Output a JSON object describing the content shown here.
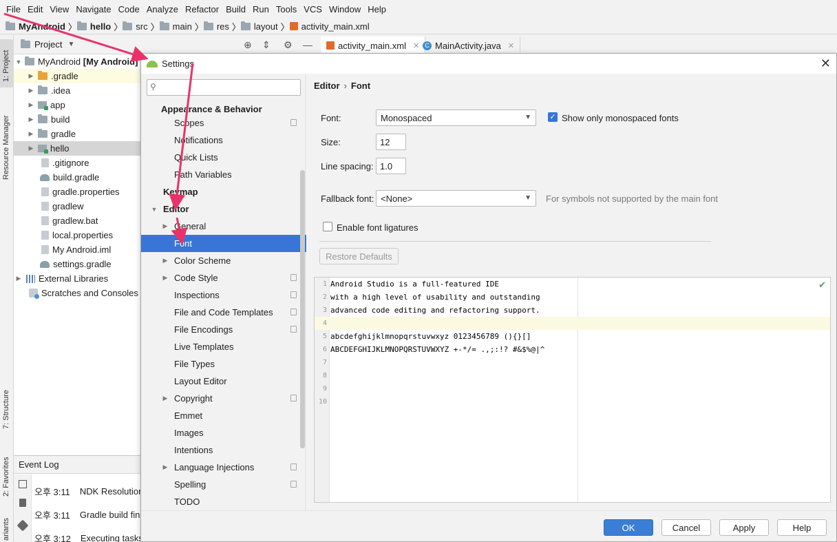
{
  "menu": [
    "File",
    "Edit",
    "View",
    "Navigate",
    "Code",
    "Analyze",
    "Refactor",
    "Build",
    "Run",
    "Tools",
    "VCS",
    "Window",
    "Help"
  ],
  "breadcrumb": [
    "MyAndroid",
    "hello",
    "src",
    "main",
    "res",
    "layout",
    "activity_main.xml"
  ],
  "left_strip": {
    "project": "1: Project",
    "resource_manager": "Resource Manager",
    "structure": "7: Structure",
    "favorites": "2: Favorites",
    "variants": "ariants"
  },
  "project_panel": {
    "header": "Project",
    "tree": [
      {
        "label": "MyAndroid",
        "suffix": "[My Android]"
      },
      {
        "label": ".gradle"
      },
      {
        "label": ".idea"
      },
      {
        "label": "app"
      },
      {
        "label": "build"
      },
      {
        "label": "gradle"
      },
      {
        "label": "hello"
      },
      {
        "label": ".gitignore"
      },
      {
        "label": "build.gradle"
      },
      {
        "label": "gradle.properties"
      },
      {
        "label": "gradlew"
      },
      {
        "label": "gradlew.bat"
      },
      {
        "label": "local.properties"
      },
      {
        "label": "My Android.iml"
      },
      {
        "label": "settings.gradle"
      },
      {
        "label": "External Libraries"
      },
      {
        "label": "Scratches and Consoles"
      }
    ]
  },
  "event_log": {
    "title": "Event Log",
    "rows": [
      {
        "time": "오후 3:11",
        "text": "NDK Resolution"
      },
      {
        "time": "오후 3:11",
        "text": "Gradle build fini"
      },
      {
        "time": "오후 3:12",
        "text": "Executing tasks:"
      }
    ]
  },
  "editor_tabs": [
    {
      "label": "activity_main.xml",
      "active": true
    },
    {
      "label": "MainActivity.java",
      "active": false
    }
  ],
  "dialog": {
    "title": "Settings",
    "nav": {
      "search_placeholder": "",
      "items": [
        {
          "label": "Appearance & Behavior"
        },
        {
          "label": "Scopes"
        },
        {
          "label": "Notifications"
        },
        {
          "label": "Quick Lists"
        },
        {
          "label": "Path Variables"
        },
        {
          "label": "Keymap"
        },
        {
          "label": "Editor"
        },
        {
          "label": "General"
        },
        {
          "label": "Font"
        },
        {
          "label": "Color Scheme"
        },
        {
          "label": "Code Style"
        },
        {
          "label": "Inspections"
        },
        {
          "label": "File and Code Templates"
        },
        {
          "label": "File Encodings"
        },
        {
          "label": "Live Templates"
        },
        {
          "label": "File Types"
        },
        {
          "label": "Layout Editor"
        },
        {
          "label": "Copyright"
        },
        {
          "label": "Emmet"
        },
        {
          "label": "Images"
        },
        {
          "label": "Intentions"
        },
        {
          "label": "Language Injections"
        },
        {
          "label": "Spelling"
        },
        {
          "label": "TODO"
        }
      ]
    },
    "content": {
      "breadcrumb": [
        "Editor",
        "Font"
      ],
      "font_label": "Font:",
      "font_value": "Monospaced",
      "show_mono_label": "Show only monospaced fonts",
      "show_mono_checked": true,
      "size_label": "Size:",
      "size_value": "12",
      "line_spacing_label": "Line spacing:",
      "line_spacing_value": "1.0",
      "fallback_label": "Fallback font:",
      "fallback_value": "<None>",
      "fallback_hint": "For symbols not supported by the main font",
      "ligatures_label": "Enable font ligatures",
      "ligatures_checked": false,
      "restore_label": "Restore Defaults",
      "preview_lines": [
        "Android Studio is a full-featured IDE",
        "with a high level of usability and outstanding",
        "advanced code editing and refactoring support.",
        "",
        "abcdefghijklmnopqrstuvwxyz 0123456789 (){}[]",
        "ABCDEFGHIJKLMNOPQRSTUVWXYZ +-*/= .,;:!? #&$%@|^",
        "",
        "",
        "",
        ""
      ]
    },
    "buttons": {
      "ok": "OK",
      "cancel": "Cancel",
      "apply": "Apply",
      "help": "Help"
    }
  },
  "colors": {
    "accent": "#3875d7",
    "annotation_arrow": "#e8336a"
  }
}
